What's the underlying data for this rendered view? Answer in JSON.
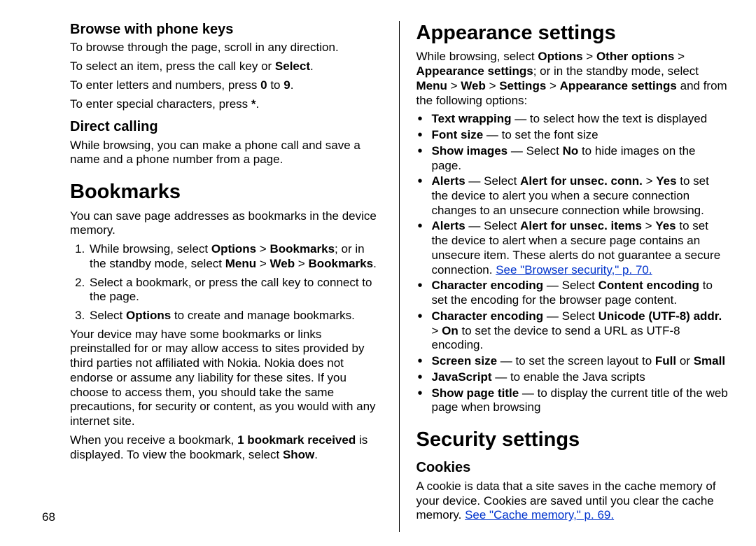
{
  "page_number": "68",
  "left": {
    "h_browse": "Browse with phone keys",
    "browse_p1_pre": "To browse through the page, scroll in any direction.",
    "browse_p2_pre": "To select an item, press the call key or ",
    "browse_p2_b1": "Select",
    "browse_p2_post": ".",
    "browse_p3_pre": "To enter letters and numbers, press ",
    "browse_p3_b1": "0",
    "browse_p3_mid": " to ",
    "browse_p3_b2": "9",
    "browse_p3_post": ".",
    "browse_p4_pre": "To enter special characters, press ",
    "browse_p4_b1": "*",
    "browse_p4_post": ".",
    "h_direct": "Direct calling",
    "direct_p1": "While browsing, you can make a phone call and save a name and a phone number from a page.",
    "h_bookmarks": "Bookmarks",
    "bm_p1": "You can save page addresses as bookmarks in the device memory.",
    "bm_li1_pre": "While browsing, select ",
    "bm_li1_b1": "Options",
    "bm_li1_mid1": " > ",
    "bm_li1_b2": "Bookmarks",
    "bm_li1_mid2": "; or in the standby mode, select ",
    "bm_li1_b3": "Menu",
    "bm_li1_mid3": " > ",
    "bm_li1_b4": "Web",
    "bm_li1_mid4": " > ",
    "bm_li1_b5": "Bookmarks",
    "bm_li1_post": ".",
    "bm_li2": "Select a bookmark, or press the call key to connect to the page.",
    "bm_li3_pre": "Select ",
    "bm_li3_b1": "Options",
    "bm_li3_post": " to create and manage bookmarks.",
    "bm_p2": "Your device may have some bookmarks or links preinstalled for or may allow access to sites provided by third parties not affiliated with Nokia. Nokia does not endorse or assume any liability for these sites. If you choose to access them, you should take the same precautions, for security or content, as you would with any internet site.",
    "bm_p3_pre": "When you receive a bookmark, ",
    "bm_p3_b1": "1 bookmark received",
    "bm_p3_mid": " is displayed. To view the bookmark, select ",
    "bm_p3_b2": "Show",
    "bm_p3_post": "."
  },
  "right": {
    "h_appearance": "Appearance settings",
    "ap_p1_pre": "While browsing, select ",
    "ap_p1_b1": "Options",
    "ap_p1_m1": " > ",
    "ap_p1_b2": "Other options",
    "ap_p1_m2": " > ",
    "ap_p1_b3": "Appearance settings",
    "ap_p1_m3": "; or in the standby mode, select ",
    "ap_p1_b4": "Menu",
    "ap_p1_m4": " > ",
    "ap_p1_b5": "Web",
    "ap_p1_m5": " > ",
    "ap_p1_b6": "Settings",
    "ap_p1_m6": " > ",
    "ap_p1_b7": "Appearance settings",
    "ap_p1_post": " and from the following options:",
    "li_tw_b": "Text wrapping",
    "li_tw_t": " — to select how the text is displayed",
    "li_fs_b": "Font size",
    "li_fs_t": " — to set the font size",
    "li_si_b": "Show images",
    "li_si_t1": " — Select ",
    "li_si_b2": "No",
    "li_si_t2": " to hide images on the page.",
    "li_al1_b": "Alerts",
    "li_al1_t1": " — Select ",
    "li_al1_b2": "Alert for unsec. conn.",
    "li_al1_t2": " > ",
    "li_al1_b3": "Yes",
    "li_al1_t3": " to set the device to alert you when a secure connection changes to an unsecure connection while browsing.",
    "li_al2_b": "Alerts",
    "li_al2_t1": " — Select ",
    "li_al2_b2": "Alert for unsec. items",
    "li_al2_t2": " > ",
    "li_al2_b3": "Yes",
    "li_al2_t3": " to set the device to alert when a secure page contains an unsecure item. These alerts do not guarantee a secure connection. ",
    "li_al2_link": "See \"Browser security,\" p. 70.",
    "li_ce1_b": "Character encoding",
    "li_ce1_t1": " — Select ",
    "li_ce1_b2": "Content encoding",
    "li_ce1_t2": " to set the encoding for the browser page content.",
    "li_ce2_b": "Character encoding",
    "li_ce2_t1": " — Select ",
    "li_ce2_b2": "Unicode (UTF-8) addr.",
    "li_ce2_t2": " > ",
    "li_ce2_b3": "On",
    "li_ce2_t3": " to set the device to send a URL as UTF-8 encoding.",
    "li_ss_b": "Screen size",
    "li_ss_t1": " — to set the screen layout to ",
    "li_ss_b2": "Full",
    "li_ss_t2": " or ",
    "li_ss_b3": "Small",
    "li_js_b": "JavaScript",
    "li_js_t": " — to enable the Java scripts",
    "li_spt_b": "Show page title",
    "li_spt_t": " — to display the current title of the web page when browsing",
    "h_security": "Security settings",
    "h_cookies": "Cookies",
    "ck_p1_pre": "A cookie is data that a site saves in the cache memory of your device. Cookies are saved until you clear the cache memory. ",
    "ck_link": "See \"Cache memory,\" p. 69."
  }
}
